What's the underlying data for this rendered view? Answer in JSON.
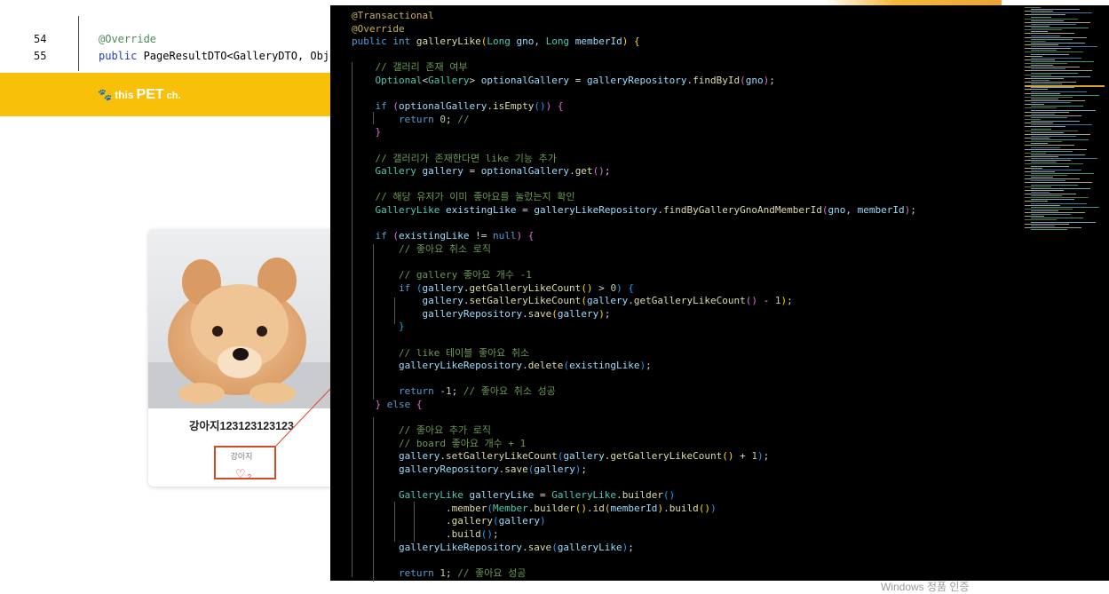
{
  "background_code": {
    "lines": [
      {
        "number": "54",
        "text": "@Override"
      },
      {
        "number": "55",
        "text_keyword": "public",
        "text_rest": " PageResultDTO<GalleryDTO, Obje"
      }
    ]
  },
  "navbar": {
    "logo_icon": "paw-icon",
    "logo_part1": "this",
    "logo_part2": "PET",
    "logo_part3": "ch."
  },
  "card": {
    "image_icon": "puppy-photo",
    "title": "강아지123123123123",
    "category": "강아지",
    "like_icon": "heart-icon",
    "like_count": "2"
  },
  "editor": {
    "lines": [
      [
        [
          "c-ann",
          "@Transactional"
        ]
      ],
      [
        [
          "c-ann",
          "@Override"
        ]
      ],
      [
        [
          "c-kw",
          "public "
        ],
        [
          "c-kw",
          "int "
        ],
        [
          "c-fn",
          "galleryLike"
        ],
        [
          "c-br",
          "("
        ],
        [
          "c-ty",
          "Long "
        ],
        [
          "c-var",
          "gno"
        ],
        [
          "c-p",
          ", "
        ],
        [
          "c-ty",
          "Long "
        ],
        [
          "c-var",
          "memberId"
        ],
        [
          "c-br",
          ")"
        ],
        [
          "c-p",
          " "
        ],
        [
          "c-br",
          "{"
        ]
      ],
      [],
      [
        [
          "c-cm",
          "    // 갤러리 존재 여부"
        ]
      ],
      [
        [
          "c-p",
          "    "
        ],
        [
          "c-ty",
          "Optional"
        ],
        [
          "c-p",
          "<"
        ],
        [
          "c-ty",
          "Gallery"
        ],
        [
          "c-p",
          "> "
        ],
        [
          "c-var",
          "optionalGallery"
        ],
        [
          "c-p",
          " = "
        ],
        [
          "c-var",
          "galleryRepository"
        ],
        [
          "c-p",
          "."
        ],
        [
          "c-fn",
          "findById"
        ],
        [
          "c-br2",
          "("
        ],
        [
          "c-var",
          "gno"
        ],
        [
          "c-br2",
          ")"
        ],
        [
          "c-p",
          ";"
        ]
      ],
      [],
      [
        [
          "c-p",
          "    "
        ],
        [
          "c-kw",
          "if "
        ],
        [
          "c-br2",
          "("
        ],
        [
          "c-var",
          "optionalGallery"
        ],
        [
          "c-p",
          "."
        ],
        [
          "c-fn",
          "isEmpty"
        ],
        [
          "c-br3",
          "()"
        ],
        [
          "c-br2",
          ")"
        ],
        [
          "c-p",
          " "
        ],
        [
          "c-br2",
          "{"
        ]
      ],
      [
        [
          "c-p",
          "        "
        ],
        [
          "c-kw",
          "return "
        ],
        [
          "c-num",
          "0"
        ],
        [
          "c-p",
          "; "
        ],
        [
          "c-cm",
          "//"
        ]
      ],
      [
        [
          "c-p",
          "    "
        ],
        [
          "c-br2",
          "}"
        ]
      ],
      [],
      [
        [
          "c-cm",
          "    // 갤러리가 존재한다면 like 기능 추가"
        ]
      ],
      [
        [
          "c-p",
          "    "
        ],
        [
          "c-ty",
          "Gallery "
        ],
        [
          "c-var",
          "gallery"
        ],
        [
          "c-p",
          " = "
        ],
        [
          "c-var",
          "optionalGallery"
        ],
        [
          "c-p",
          "."
        ],
        [
          "c-fn",
          "get"
        ],
        [
          "c-br2",
          "()"
        ],
        [
          "c-p",
          ";"
        ]
      ],
      [],
      [
        [
          "c-cm",
          "    // 해당 유저가 이미 좋아요를 눌렀는지 확인"
        ]
      ],
      [
        [
          "c-p",
          "    "
        ],
        [
          "c-ty",
          "GalleryLike "
        ],
        [
          "c-var",
          "existingLike"
        ],
        [
          "c-p",
          " = "
        ],
        [
          "c-var",
          "galleryLikeRepository"
        ],
        [
          "c-p",
          "."
        ],
        [
          "c-fn",
          "findByGalleryGnoAndMemberId"
        ],
        [
          "c-br2",
          "("
        ],
        [
          "c-var",
          "gno"
        ],
        [
          "c-p",
          ", "
        ],
        [
          "c-var",
          "memberId"
        ],
        [
          "c-br2",
          ")"
        ],
        [
          "c-p",
          ";"
        ]
      ],
      [],
      [
        [
          "c-p",
          "    "
        ],
        [
          "c-kw",
          "if "
        ],
        [
          "c-br2",
          "("
        ],
        [
          "c-var",
          "existingLike"
        ],
        [
          "c-p",
          " != "
        ],
        [
          "c-kw",
          "null"
        ],
        [
          "c-br2",
          ")"
        ],
        [
          "c-p",
          " "
        ],
        [
          "c-br2",
          "{"
        ]
      ],
      [
        [
          "c-cm",
          "        // 좋아요 취소 로직"
        ]
      ],
      [],
      [
        [
          "c-cm",
          "        // gallery 좋아요 개수 -1"
        ]
      ],
      [
        [
          "c-p",
          "        "
        ],
        [
          "c-kw",
          "if "
        ],
        [
          "c-br3",
          "("
        ],
        [
          "c-var",
          "gallery"
        ],
        [
          "c-p",
          "."
        ],
        [
          "c-fn",
          "getGalleryLikeCount"
        ],
        [
          "c-br",
          "()"
        ],
        [
          "c-p",
          " > "
        ],
        [
          "c-num",
          "0"
        ],
        [
          "c-br3",
          ")"
        ],
        [
          "c-p",
          " "
        ],
        [
          "c-br3",
          "{"
        ]
      ],
      [
        [
          "c-p",
          "            "
        ],
        [
          "c-var",
          "gallery"
        ],
        [
          "c-p",
          "."
        ],
        [
          "c-fn",
          "setGalleryLikeCount"
        ],
        [
          "c-br",
          "("
        ],
        [
          "c-var",
          "gallery"
        ],
        [
          "c-p",
          "."
        ],
        [
          "c-fn",
          "getGalleryLikeCount"
        ],
        [
          "c-br2",
          "()"
        ],
        [
          "c-p",
          " - "
        ],
        [
          "c-num",
          "1"
        ],
        [
          "c-br",
          ")"
        ],
        [
          "c-p",
          ";"
        ]
      ],
      [
        [
          "c-p",
          "            "
        ],
        [
          "c-var",
          "galleryRepository"
        ],
        [
          "c-p",
          "."
        ],
        [
          "c-fn",
          "save"
        ],
        [
          "c-br",
          "("
        ],
        [
          "c-var",
          "gallery"
        ],
        [
          "c-br",
          ")"
        ],
        [
          "c-p",
          ";"
        ]
      ],
      [
        [
          "c-p",
          "        "
        ],
        [
          "c-br3",
          "}"
        ]
      ],
      [],
      [
        [
          "c-cm",
          "        // like 테이블 좋아요 취소"
        ]
      ],
      [
        [
          "c-p",
          "        "
        ],
        [
          "c-var",
          "galleryLikeRepository"
        ],
        [
          "c-p",
          "."
        ],
        [
          "c-fn",
          "delete"
        ],
        [
          "c-br3",
          "("
        ],
        [
          "c-var",
          "existingLike"
        ],
        [
          "c-br3",
          ")"
        ],
        [
          "c-p",
          ";"
        ]
      ],
      [],
      [
        [
          "c-p",
          "        "
        ],
        [
          "c-kw",
          "return "
        ],
        [
          "c-p",
          "-"
        ],
        [
          "c-num",
          "1"
        ],
        [
          "c-p",
          "; "
        ],
        [
          "c-cm",
          "// 좋아요 취소 성공"
        ]
      ],
      [
        [
          "c-p",
          "    "
        ],
        [
          "c-br2",
          "}"
        ],
        [
          "c-kw",
          " else "
        ],
        [
          "c-br2",
          "{"
        ]
      ],
      [],
      [
        [
          "c-cm",
          "        // 좋아요 추가 로직"
        ]
      ],
      [
        [
          "c-cm",
          "        // board 좋아요 개수 + 1"
        ]
      ],
      [
        [
          "c-p",
          "        "
        ],
        [
          "c-var",
          "gallery"
        ],
        [
          "c-p",
          "."
        ],
        [
          "c-fn",
          "setGalleryLikeCount"
        ],
        [
          "c-br3",
          "("
        ],
        [
          "c-var",
          "gallery"
        ],
        [
          "c-p",
          "."
        ],
        [
          "c-fn",
          "getGalleryLikeCount"
        ],
        [
          "c-br",
          "()"
        ],
        [
          "c-p",
          " + "
        ],
        [
          "c-num",
          "1"
        ],
        [
          "c-br3",
          ")"
        ],
        [
          "c-p",
          ";"
        ]
      ],
      [
        [
          "c-p",
          "        "
        ],
        [
          "c-var",
          "galleryRepository"
        ],
        [
          "c-p",
          "."
        ],
        [
          "c-fn",
          "save"
        ],
        [
          "c-br3",
          "("
        ],
        [
          "c-var",
          "gallery"
        ],
        [
          "c-br3",
          ")"
        ],
        [
          "c-p",
          ";"
        ]
      ],
      [],
      [
        [
          "c-p",
          "        "
        ],
        [
          "c-ty",
          "GalleryLike "
        ],
        [
          "c-var",
          "galleryLike"
        ],
        [
          "c-p",
          " = "
        ],
        [
          "c-ty",
          "GalleryLike"
        ],
        [
          "c-p",
          "."
        ],
        [
          "c-fn",
          "builder"
        ],
        [
          "c-br3",
          "()"
        ]
      ],
      [
        [
          "c-p",
          "                "
        ],
        [
          "c-p",
          "."
        ],
        [
          "c-fn",
          "member"
        ],
        [
          "c-br3",
          "("
        ],
        [
          "c-ty",
          "Member"
        ],
        [
          "c-p",
          "."
        ],
        [
          "c-fn",
          "builder"
        ],
        [
          "c-br",
          "()"
        ],
        [
          "c-p",
          "."
        ],
        [
          "c-fn",
          "id"
        ],
        [
          "c-br",
          "("
        ],
        [
          "c-var",
          "memberId"
        ],
        [
          "c-br",
          ")"
        ],
        [
          "c-p",
          "."
        ],
        [
          "c-fn",
          "build"
        ],
        [
          "c-br",
          "()"
        ],
        [
          "c-br3",
          ")"
        ]
      ],
      [
        [
          "c-p",
          "                "
        ],
        [
          "c-p",
          "."
        ],
        [
          "c-fn",
          "gallery"
        ],
        [
          "c-br3",
          "("
        ],
        [
          "c-var",
          "gallery"
        ],
        [
          "c-br3",
          ")"
        ]
      ],
      [
        [
          "c-p",
          "                "
        ],
        [
          "c-p",
          "."
        ],
        [
          "c-fn",
          "build"
        ],
        [
          "c-br3",
          "()"
        ],
        [
          "c-p",
          ";"
        ]
      ],
      [
        [
          "c-p",
          "        "
        ],
        [
          "c-var",
          "galleryLikeRepository"
        ],
        [
          "c-p",
          "."
        ],
        [
          "c-fn",
          "save"
        ],
        [
          "c-br3",
          "("
        ],
        [
          "c-var",
          "galleryLike"
        ],
        [
          "c-br3",
          ")"
        ],
        [
          "c-p",
          ";"
        ]
      ],
      [],
      [
        [
          "c-p",
          "        "
        ],
        [
          "c-kw",
          "return "
        ],
        [
          "c-num",
          "1"
        ],
        [
          "c-p",
          "; "
        ],
        [
          "c-cm",
          "// 좋아요 성공"
        ]
      ]
    ]
  },
  "watermark": "Windows 정품 인증",
  "colors": {
    "navbar": "#f9c00a",
    "editor_bg": "#000000",
    "highlight_box": "#d64a2a"
  }
}
